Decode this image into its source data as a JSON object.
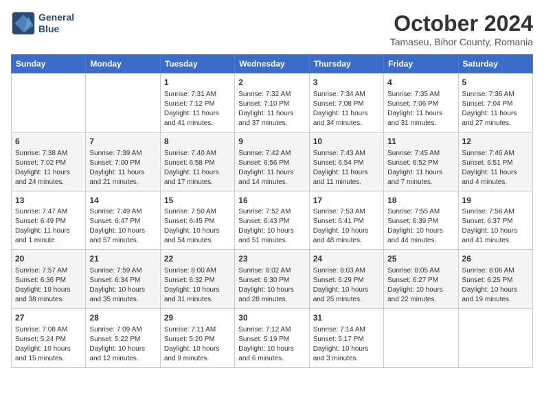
{
  "header": {
    "logo_line1": "General",
    "logo_line2": "Blue",
    "month": "October 2024",
    "location": "Tamaseu, Bihor County, Romania"
  },
  "weekdays": [
    "Sunday",
    "Monday",
    "Tuesday",
    "Wednesday",
    "Thursday",
    "Friday",
    "Saturday"
  ],
  "weeks": [
    [
      {
        "day": "",
        "info": ""
      },
      {
        "day": "",
        "info": ""
      },
      {
        "day": "1",
        "info": "Sunrise: 7:31 AM\nSunset: 7:12 PM\nDaylight: 11 hours and 41 minutes."
      },
      {
        "day": "2",
        "info": "Sunrise: 7:32 AM\nSunset: 7:10 PM\nDaylight: 11 hours and 37 minutes."
      },
      {
        "day": "3",
        "info": "Sunrise: 7:34 AM\nSunset: 7:08 PM\nDaylight: 11 hours and 34 minutes."
      },
      {
        "day": "4",
        "info": "Sunrise: 7:35 AM\nSunset: 7:06 PM\nDaylight: 11 hours and 31 minutes."
      },
      {
        "day": "5",
        "info": "Sunrise: 7:36 AM\nSunset: 7:04 PM\nDaylight: 11 hours and 27 minutes."
      }
    ],
    [
      {
        "day": "6",
        "info": "Sunrise: 7:38 AM\nSunset: 7:02 PM\nDaylight: 11 hours and 24 minutes."
      },
      {
        "day": "7",
        "info": "Sunrise: 7:39 AM\nSunset: 7:00 PM\nDaylight: 11 hours and 21 minutes."
      },
      {
        "day": "8",
        "info": "Sunrise: 7:40 AM\nSunset: 6:58 PM\nDaylight: 11 hours and 17 minutes."
      },
      {
        "day": "9",
        "info": "Sunrise: 7:42 AM\nSunset: 6:56 PM\nDaylight: 11 hours and 14 minutes."
      },
      {
        "day": "10",
        "info": "Sunrise: 7:43 AM\nSunset: 6:54 PM\nDaylight: 11 hours and 11 minutes."
      },
      {
        "day": "11",
        "info": "Sunrise: 7:45 AM\nSunset: 6:52 PM\nDaylight: 11 hours and 7 minutes."
      },
      {
        "day": "12",
        "info": "Sunrise: 7:46 AM\nSunset: 6:51 PM\nDaylight: 11 hours and 4 minutes."
      }
    ],
    [
      {
        "day": "13",
        "info": "Sunrise: 7:47 AM\nSunset: 6:49 PM\nDaylight: 11 hours and 1 minute."
      },
      {
        "day": "14",
        "info": "Sunrise: 7:49 AM\nSunset: 6:47 PM\nDaylight: 10 hours and 57 minutes."
      },
      {
        "day": "15",
        "info": "Sunrise: 7:50 AM\nSunset: 6:45 PM\nDaylight: 10 hours and 54 minutes."
      },
      {
        "day": "16",
        "info": "Sunrise: 7:52 AM\nSunset: 6:43 PM\nDaylight: 10 hours and 51 minutes."
      },
      {
        "day": "17",
        "info": "Sunrise: 7:53 AM\nSunset: 6:41 PM\nDaylight: 10 hours and 48 minutes."
      },
      {
        "day": "18",
        "info": "Sunrise: 7:55 AM\nSunset: 6:39 PM\nDaylight: 10 hours and 44 minutes."
      },
      {
        "day": "19",
        "info": "Sunrise: 7:56 AM\nSunset: 6:37 PM\nDaylight: 10 hours and 41 minutes."
      }
    ],
    [
      {
        "day": "20",
        "info": "Sunrise: 7:57 AM\nSunset: 6:36 PM\nDaylight: 10 hours and 38 minutes."
      },
      {
        "day": "21",
        "info": "Sunrise: 7:59 AM\nSunset: 6:34 PM\nDaylight: 10 hours and 35 minutes."
      },
      {
        "day": "22",
        "info": "Sunrise: 8:00 AM\nSunset: 6:32 PM\nDaylight: 10 hours and 31 minutes."
      },
      {
        "day": "23",
        "info": "Sunrise: 8:02 AM\nSunset: 6:30 PM\nDaylight: 10 hours and 28 minutes."
      },
      {
        "day": "24",
        "info": "Sunrise: 8:03 AM\nSunset: 6:29 PM\nDaylight: 10 hours and 25 minutes."
      },
      {
        "day": "25",
        "info": "Sunrise: 8:05 AM\nSunset: 6:27 PM\nDaylight: 10 hours and 22 minutes."
      },
      {
        "day": "26",
        "info": "Sunrise: 8:06 AM\nSunset: 6:25 PM\nDaylight: 10 hours and 19 minutes."
      }
    ],
    [
      {
        "day": "27",
        "info": "Sunrise: 7:08 AM\nSunset: 5:24 PM\nDaylight: 10 hours and 15 minutes."
      },
      {
        "day": "28",
        "info": "Sunrise: 7:09 AM\nSunset: 5:22 PM\nDaylight: 10 hours and 12 minutes."
      },
      {
        "day": "29",
        "info": "Sunrise: 7:11 AM\nSunset: 5:20 PM\nDaylight: 10 hours and 9 minutes."
      },
      {
        "day": "30",
        "info": "Sunrise: 7:12 AM\nSunset: 5:19 PM\nDaylight: 10 hours and 6 minutes."
      },
      {
        "day": "31",
        "info": "Sunrise: 7:14 AM\nSunset: 5:17 PM\nDaylight: 10 hours and 3 minutes."
      },
      {
        "day": "",
        "info": ""
      },
      {
        "day": "",
        "info": ""
      }
    ]
  ]
}
